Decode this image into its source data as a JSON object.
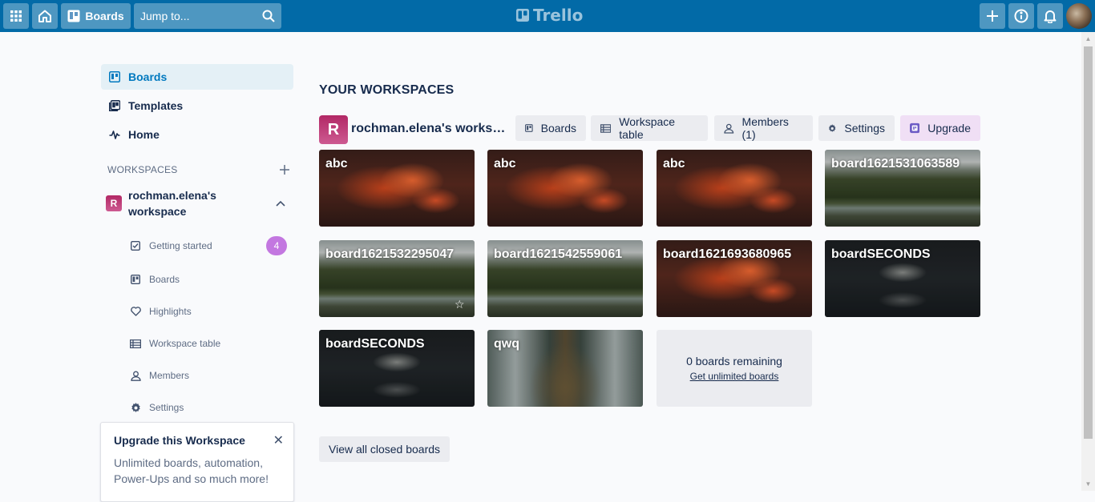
{
  "topbar": {
    "boards_label": "Boards",
    "search_placeholder": "Jump to...",
    "logo_text": "Trello"
  },
  "sidebar": {
    "nav": [
      {
        "label": "Boards",
        "icon": "board-icon",
        "active": true
      },
      {
        "label": "Templates",
        "icon": "template-icon"
      },
      {
        "label": "Home",
        "icon": "activity-icon"
      }
    ],
    "workspaces_heading": "WORKSPACES",
    "workspace": {
      "badge": "R",
      "name": "rochman.elena's workspace"
    },
    "sub_items": [
      {
        "label": "Getting started",
        "icon": "checklist-icon",
        "count": "4"
      },
      {
        "label": "Boards",
        "icon": "board-icon"
      },
      {
        "label": "Highlights",
        "icon": "heart-icon"
      },
      {
        "label": "Workspace table",
        "icon": "table-icon"
      },
      {
        "label": "Members",
        "icon": "members-icon"
      },
      {
        "label": "Settings",
        "icon": "gear-icon"
      }
    ],
    "upgrade_card": {
      "title": "Upgrade this Workspace",
      "body": "Unlimited boards, automation, Power-Ups and so much more!"
    }
  },
  "main": {
    "section_title": "YOUR WORKSPACES",
    "workspace_badge": "R",
    "workspace_name": "rochman.elena's workspace",
    "tabs": [
      {
        "label": "Boards",
        "icon": "board-icon"
      },
      {
        "label": "Workspace table",
        "icon": "table-icon"
      },
      {
        "label": "Members (1)",
        "icon": "members-icon"
      },
      {
        "label": "Settings",
        "icon": "gear-icon"
      },
      {
        "label": "Upgrade",
        "icon": "upgrade-icon"
      }
    ],
    "boards": [
      {
        "title": "abc",
        "background": "clouds"
      },
      {
        "title": "abc",
        "background": "clouds"
      },
      {
        "title": "abc",
        "background": "clouds"
      },
      {
        "title": "board1621531063589",
        "background": "forest"
      },
      {
        "title": "board1621532295047",
        "background": "forest",
        "starred_hover": true
      },
      {
        "title": "board1621542559061",
        "background": "forest"
      },
      {
        "title": "board1621693680965",
        "background": "clouds"
      },
      {
        "title": "boardSECONDS",
        "background": "night"
      },
      {
        "title": "boardSECONDS",
        "background": "night"
      },
      {
        "title": "qwq",
        "background": "tree"
      }
    ],
    "remaining": {
      "count_text": "0 boards remaining",
      "link_text": "Get unlimited boards"
    },
    "closed_boards_label": "View all closed boards"
  }
}
